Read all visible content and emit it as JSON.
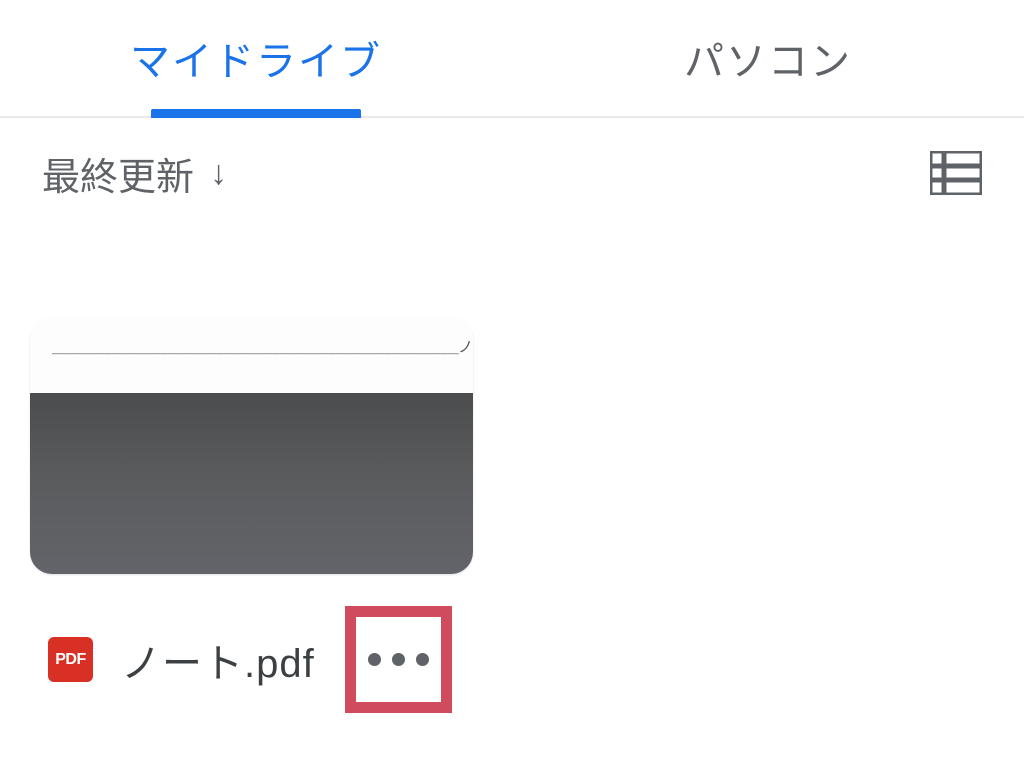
{
  "tabs": {
    "mydrive": "マイドライブ",
    "computer": "パソコン"
  },
  "sort": {
    "label": "最終更新",
    "direction_glyph": "↓"
  },
  "files": [
    {
      "preview_text": "＿＿＿＿＿＿＿＿＿＿＿＿＿＿＿＿＿＿＿＿＿＿＿＿＿＿＿＿＿ノ",
      "type_badge": "PDF",
      "name": "ノート.pdf"
    }
  ],
  "icons": {
    "view_list": "list-view-icon",
    "more": "more-horizontal-icon",
    "pdf": "pdf-icon"
  },
  "colors": {
    "active": "#1a73e8",
    "muted": "#5f6368",
    "pdf_red": "#d93025",
    "highlight_box": "#cf4b5d"
  }
}
